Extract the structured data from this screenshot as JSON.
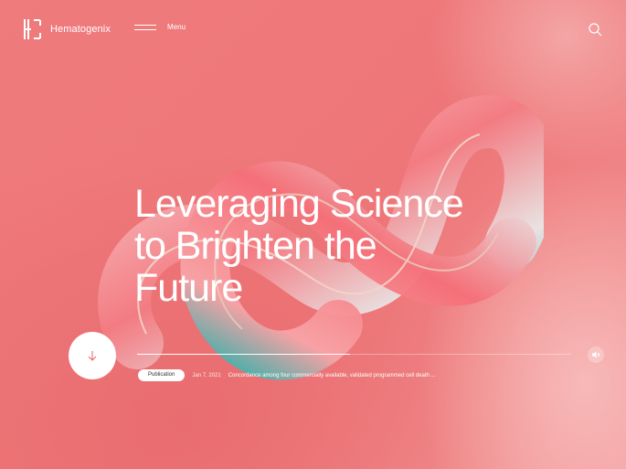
{
  "brand": {
    "name": "Hematogenix",
    "logo_icon": "hx-logo-icon"
  },
  "nav": {
    "menu_label": "Menu",
    "search_icon": "search-icon"
  },
  "hero": {
    "title_lines": [
      "Leveraging Science",
      "to Brighten the",
      "Future"
    ]
  },
  "controls": {
    "scroll_icon": "arrow-down-icon",
    "sound_icon": "speaker-icon",
    "progress": 0.49
  },
  "news": {
    "badge": "Publication",
    "date": "Jan 7, 2021",
    "headline": "Concordance among four commercially available, validated programmed cell death ..."
  },
  "colors": {
    "background": "#ee7a7c",
    "text": "#ffffff",
    "accent": "#3fb3ad"
  }
}
